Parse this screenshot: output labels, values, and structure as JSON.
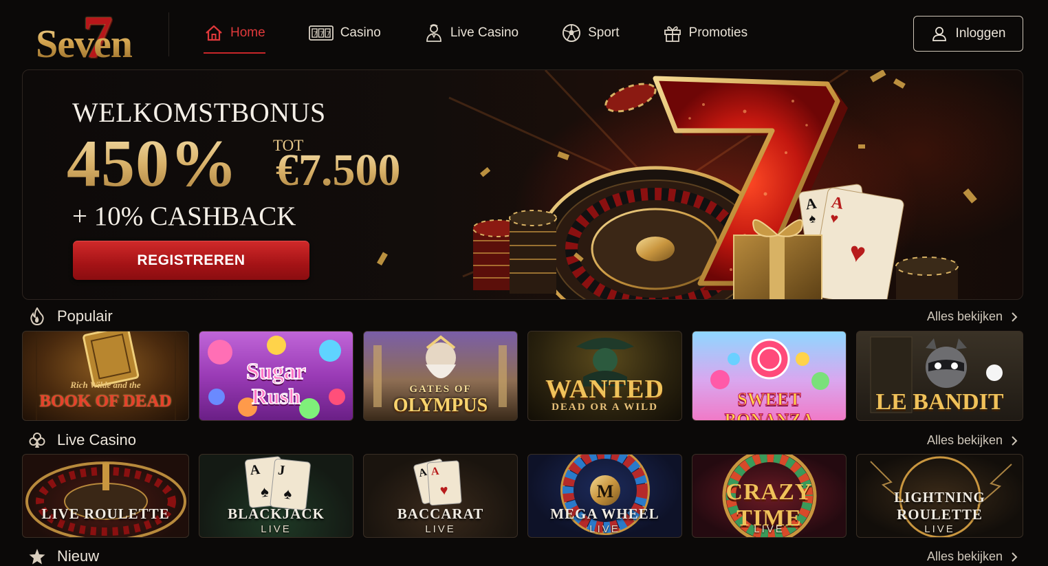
{
  "brand": {
    "logo_text": "Seven",
    "logo_digit": "7"
  },
  "nav": [
    {
      "label": "Home",
      "icon": "home-icon",
      "active": true
    },
    {
      "label": "Casino",
      "icon": "slot-machine-icon",
      "active": false
    },
    {
      "label": "Live Casino",
      "icon": "dealer-icon",
      "active": false
    },
    {
      "label": "Sport",
      "icon": "soccer-ball-icon",
      "active": false
    },
    {
      "label": "Promoties",
      "icon": "gift-icon",
      "active": false
    }
  ],
  "login": {
    "label": "Inloggen",
    "icon": "user-icon"
  },
  "hero": {
    "title": "WELKOMSTBONUS",
    "percent": "450%",
    "tot": "TOT",
    "amount": "€7.500",
    "cashback": "+ 10% CASHBACK",
    "cta": "REGISTREREN"
  },
  "sections": {
    "popular": {
      "title": "Populair",
      "icon": "flame-icon",
      "more": "Alles bekijken",
      "games": [
        {
          "line1": "Rich Wilde and the",
          "line2": "BOOK OF DEAD"
        },
        {
          "line1": "Sugar",
          "line2": "Rush"
        },
        {
          "line1": "GATES OF",
          "line2": "OLYMPUS"
        },
        {
          "line1": "WANTED",
          "line2": "DEAD OR A WILD"
        },
        {
          "line1": "SWEET BONANZA",
          "line2": ""
        },
        {
          "line1": "LE BANDIT",
          "line2": ""
        }
      ]
    },
    "live": {
      "title": "Live Casino",
      "icon": "club-icon",
      "more": "Alles bekijken",
      "games": [
        {
          "line1": "LIVE ROULETTE",
          "line2": ""
        },
        {
          "line1": "BLACKJACK",
          "line2": "LIVE"
        },
        {
          "line1": "BACCARAT",
          "line2": "LIVE"
        },
        {
          "line1": "MEGA WHEEL",
          "line2": "LIVE"
        },
        {
          "line1": "CRAZY TIME",
          "line2": "LIVE"
        },
        {
          "line1": "LIGHTNING ROULETTE",
          "line2": "LIVE"
        }
      ]
    },
    "new": {
      "title": "Nieuw",
      "icon": "star-icon",
      "more": "Alles bekijken"
    }
  },
  "colors": {
    "accent_red": "#c92629",
    "gold": "#d9b26a",
    "background": "#0b0908"
  }
}
